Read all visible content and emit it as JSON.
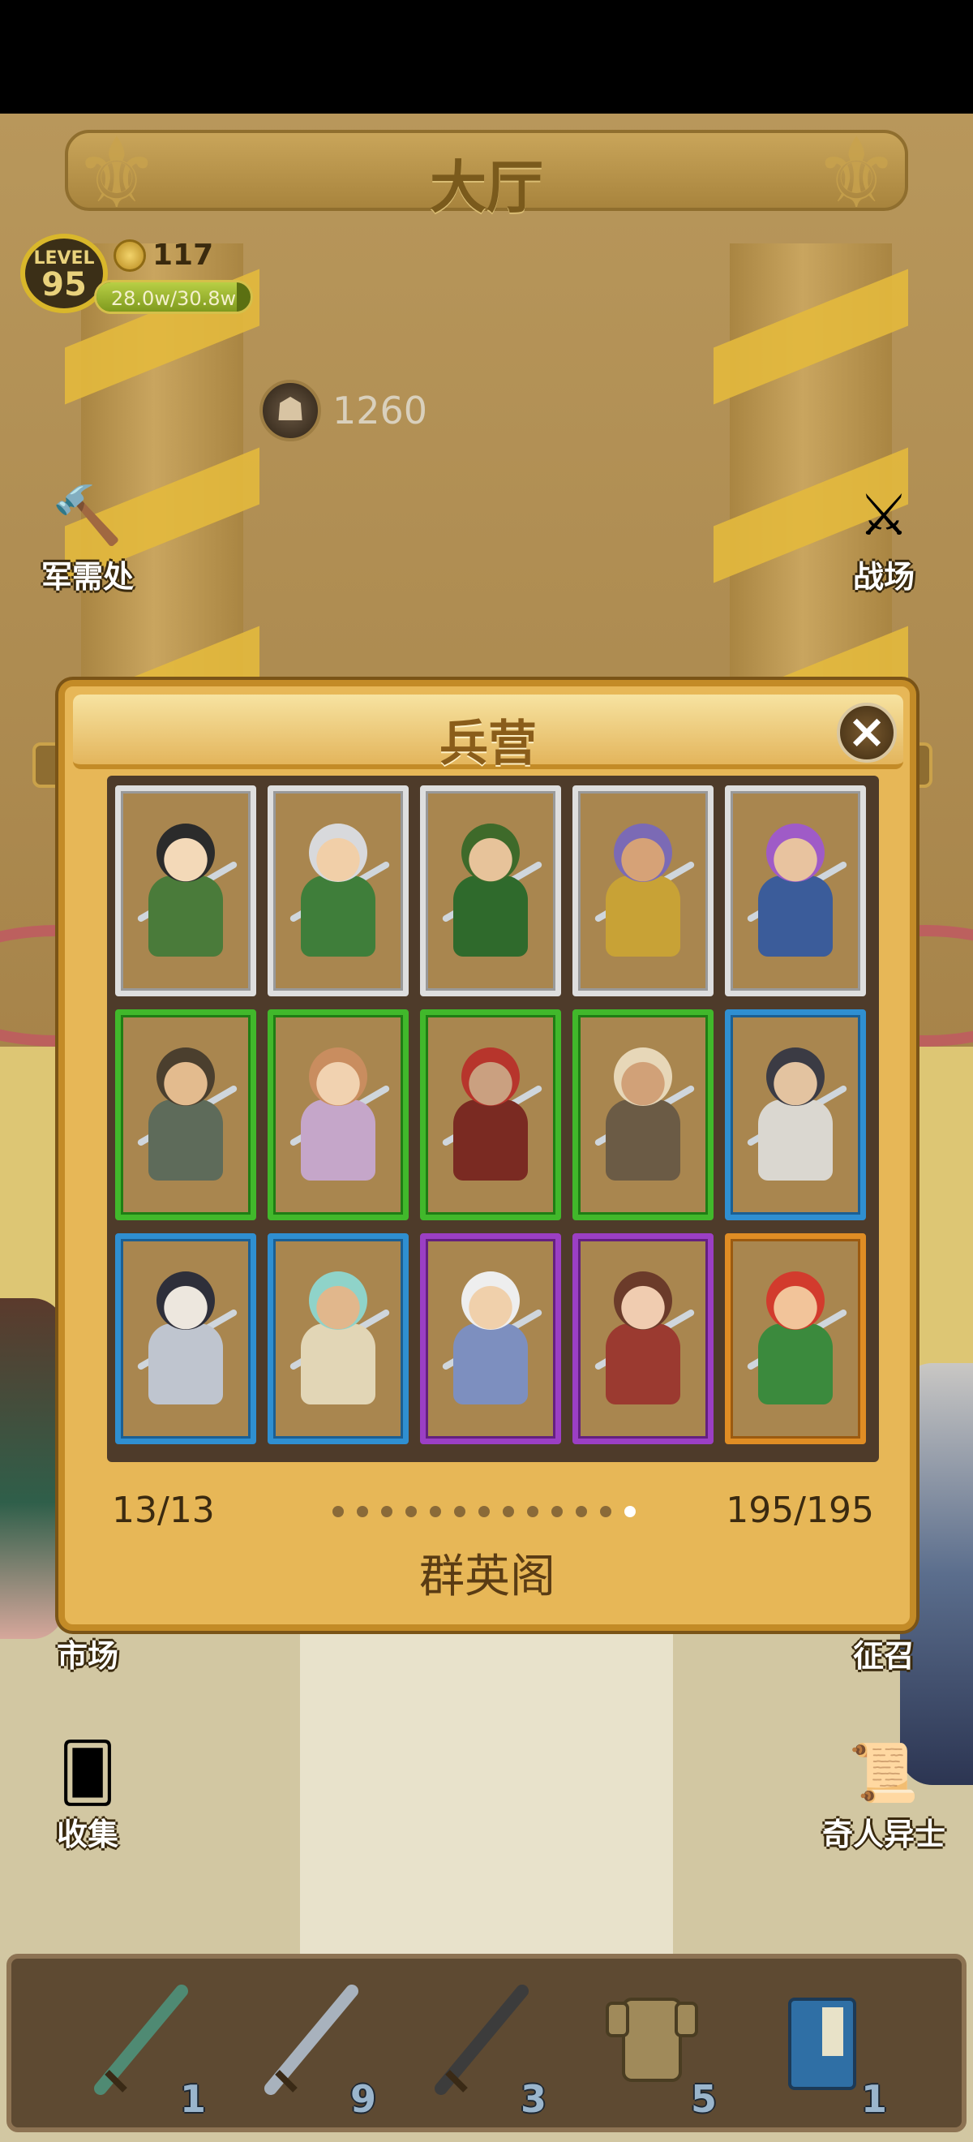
{
  "hall": {
    "title": "大厅"
  },
  "player": {
    "level_label": "LEVEL",
    "level": "95",
    "coins": "117",
    "exp_text": "28.0w/30.8w",
    "exp_progress": 0.91,
    "power": "1260"
  },
  "side_buttons": {
    "supply": "军需处",
    "battlefield": "战场",
    "market": "市场",
    "recruit": "征召",
    "collect": "收集",
    "special": "奇人异士"
  },
  "modal": {
    "title": "兵营",
    "close_icon": "close-icon",
    "page_count": "13/13",
    "total_count": "195/195",
    "building_name": "群英阁",
    "pages_total": 13,
    "current_page": 13,
    "cards": [
      {
        "rarity": "grey",
        "colors": [
          "#2b2b2b",
          "#4a7b3a",
          "#f3d9b8"
        ]
      },
      {
        "rarity": "grey",
        "colors": [
          "#d8d9dc",
          "#3f7e3a",
          "#f1cfa8"
        ]
      },
      {
        "rarity": "grey",
        "colors": [
          "#3e6a2a",
          "#2f6a2c",
          "#e7c39a"
        ]
      },
      {
        "rarity": "grey",
        "colors": [
          "#7b6ab5",
          "#c8a236",
          "#d6a277"
        ]
      },
      {
        "rarity": "grey",
        "colors": [
          "#9f5bc7",
          "#3b5c9a",
          "#e8c39f"
        ]
      },
      {
        "rarity": "green",
        "colors": [
          "#4b3f2e",
          "#5e6b5a",
          "#e3bb8e"
        ]
      },
      {
        "rarity": "green",
        "colors": [
          "#c98d5f",
          "#c5a6c9",
          "#f1d2b0"
        ]
      },
      {
        "rarity": "green",
        "colors": [
          "#b7352c",
          "#7a2a22",
          "#caa080"
        ]
      },
      {
        "rarity": "green",
        "colors": [
          "#e7d7b8",
          "#6b5b45",
          "#d1a178"
        ]
      },
      {
        "rarity": "blue",
        "colors": [
          "#3b3b44",
          "#dad7d0",
          "#e3c3a0"
        ]
      },
      {
        "rarity": "blue",
        "colors": [
          "#2e2f3a",
          "#bfc5cf",
          "#ede7de"
        ]
      },
      {
        "rarity": "blue",
        "colors": [
          "#8fd3c9",
          "#e2d6b6",
          "#e1b78c"
        ]
      },
      {
        "rarity": "purple",
        "colors": [
          "#eeeeee",
          "#7d8fbf",
          "#f0d0ab"
        ]
      },
      {
        "rarity": "purple",
        "colors": [
          "#6b3b2a",
          "#9b3a30",
          "#f0ccb0"
        ]
      },
      {
        "rarity": "orange",
        "colors": [
          "#d23b2d",
          "#3b8a3d",
          "#f2c49a"
        ]
      }
    ]
  },
  "tray": {
    "items": [
      {
        "icon": "green-sword-icon",
        "count": "1",
        "color": "#4f8a73"
      },
      {
        "icon": "broad-blade-icon",
        "count": "9",
        "color": "#a8b2bd"
      },
      {
        "icon": "spear-icon",
        "count": "3",
        "color": "#3c3c3c"
      },
      {
        "icon": "armor-icon",
        "count": "5",
        "color": "#a08a5a"
      },
      {
        "icon": "book-icon",
        "count": "1",
        "color": "#2f6fa5"
      }
    ]
  }
}
